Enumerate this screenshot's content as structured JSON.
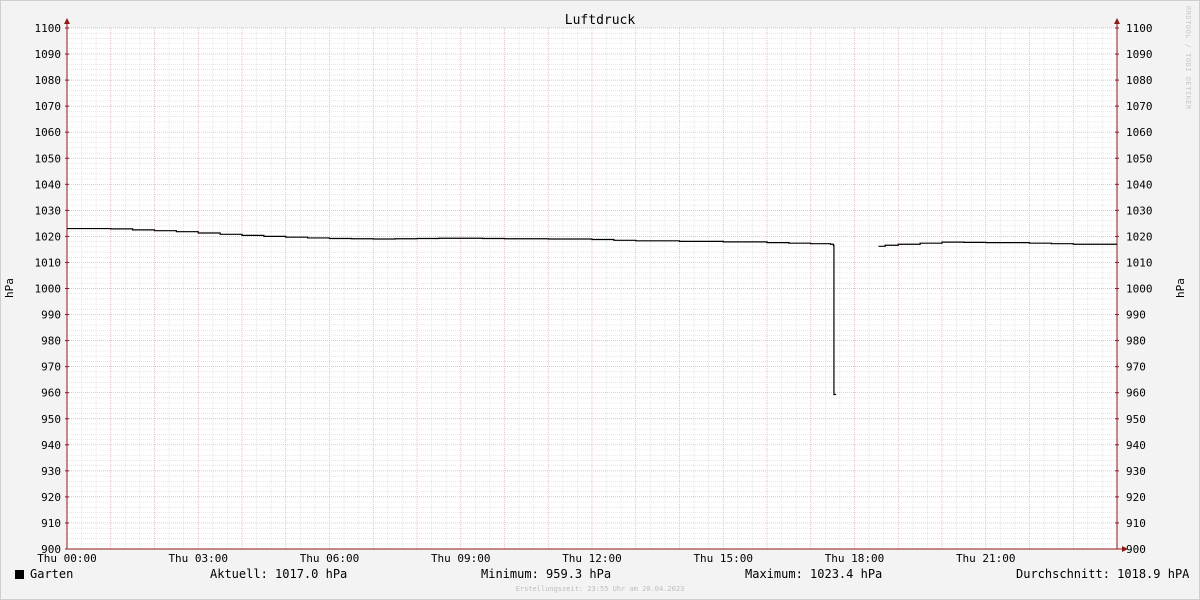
{
  "chart_data": {
    "type": "line",
    "title": "Luftdruck",
    "ylabel_left": "hPa",
    "ylabel_right": "hPa",
    "ylim": [
      900,
      1100
    ],
    "y_ticks": [
      900,
      910,
      920,
      930,
      940,
      950,
      960,
      970,
      980,
      990,
      1000,
      1010,
      1020,
      1030,
      1040,
      1050,
      1060,
      1070,
      1080,
      1090,
      1100
    ],
    "xlim": [
      0,
      24
    ],
    "x_ticks": [
      {
        "hour": 0,
        "label": "Thu 00:00"
      },
      {
        "hour": 3,
        "label": "Thu 03:00"
      },
      {
        "hour": 6,
        "label": "Thu 06:00"
      },
      {
        "hour": 9,
        "label": "Thu 09:00"
      },
      {
        "hour": 12,
        "label": "Thu 12:00"
      },
      {
        "hour": 15,
        "label": "Thu 15:00"
      },
      {
        "hour": 18,
        "label": "Thu 18:00"
      },
      {
        "hour": 21,
        "label": "Thu 21:00"
      }
    ],
    "grid": true,
    "series": [
      {
        "name": "Garten",
        "color": "#000000",
        "segments": [
          [
            [
              0.0,
              1023.0
            ],
            [
              1.0,
              1022.9
            ],
            [
              1.5,
              1022.5
            ],
            [
              2.0,
              1022.2
            ],
            [
              2.5,
              1021.8
            ],
            [
              3.0,
              1021.3
            ],
            [
              3.5,
              1020.8
            ],
            [
              4.0,
              1020.4
            ],
            [
              4.5,
              1020.0
            ],
            [
              5.0,
              1019.7
            ],
            [
              5.5,
              1019.4
            ],
            [
              6.0,
              1019.2
            ],
            [
              6.5,
              1019.1
            ],
            [
              7.0,
              1019.0
            ],
            [
              7.5,
              1019.1
            ],
            [
              8.0,
              1019.2
            ],
            [
              8.5,
              1019.3
            ],
            [
              9.0,
              1019.3
            ],
            [
              9.5,
              1019.2
            ],
            [
              10.0,
              1019.1
            ],
            [
              11.0,
              1019.0
            ],
            [
              12.0,
              1018.8
            ],
            [
              12.5,
              1018.5
            ],
            [
              13.0,
              1018.3
            ],
            [
              14.0,
              1018.1
            ],
            [
              15.0,
              1017.9
            ],
            [
              16.0,
              1017.6
            ],
            [
              16.5,
              1017.4
            ],
            [
              17.0,
              1017.2
            ],
            [
              17.45,
              1017.0
            ],
            [
              17.52,
              1016.5
            ],
            [
              17.53,
              959.3
            ],
            [
              17.58,
              959.3
            ]
          ],
          [
            [
              18.55,
              1016.2
            ],
            [
              18.7,
              1016.6
            ],
            [
              19.0,
              1017.0
            ],
            [
              19.5,
              1017.4
            ],
            [
              20.0,
              1017.8
            ],
            [
              20.5,
              1017.7
            ],
            [
              21.0,
              1017.6
            ],
            [
              22.0,
              1017.4
            ],
            [
              22.5,
              1017.2
            ],
            [
              23.0,
              1017.0
            ],
            [
              24.0,
              1017.0
            ]
          ]
        ]
      }
    ]
  },
  "legend": {
    "series_label": "Garten",
    "current": "Aktuell: 1017.0 hPa",
    "minimum": "Minimum: 959.3 hPa",
    "maximum": "Maximum: 1023.4 hPa",
    "average": "Durchschnitt: 1018.9 hPA"
  },
  "footer": "Erstellungszeit: 23:55 Uhr am 20.04.2023",
  "watermark": "RRDTOOL / TOBI OETIKER",
  "colors": {
    "background": "#f3f3f3",
    "plot_area": "#ffffff",
    "major_grid": "#e6a8a8",
    "minor_grid": "#d9d9d9",
    "axis": "#8c1a1a",
    "line": "#000000"
  }
}
